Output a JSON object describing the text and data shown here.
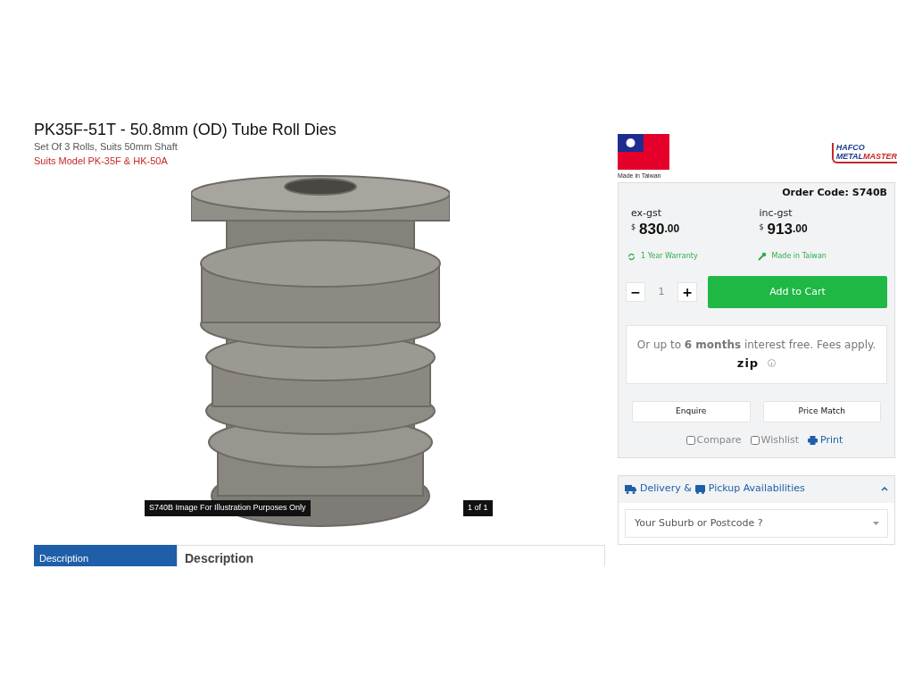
{
  "product": {
    "title": "PK35F-51T - 50.8mm (OD) Tube Roll Dies",
    "subtitle": "Set Of 3 Rolls, Suits 50mm Shaft",
    "suits": "Suits Model PK-35F & HK-50A"
  },
  "gallery": {
    "caption": "S740B Image For Illustration Purposes Only",
    "counter": "1 of 1"
  },
  "tabs": [
    {
      "label": "Description",
      "selected": true
    }
  ],
  "description_heading": "Description",
  "origin": {
    "label": "Made in Taiwan"
  },
  "brand": {
    "line1": "HAFCO",
    "line2a": "METAL",
    "line2b": "MASTER"
  },
  "buy_box": {
    "order_code": "Order Code: S740B",
    "prices": [
      {
        "label": "ex-gst",
        "currency": "$",
        "whole": "830",
        "cents": ".00"
      },
      {
        "label": "inc-gst",
        "currency": "$",
        "whole": "913",
        "cents": ".00"
      }
    ],
    "features": [
      {
        "kind": "warranty",
        "text": "1 Year Warranty"
      },
      {
        "kind": "origin",
        "text": "Made in Taiwan"
      }
    ],
    "quantity": {
      "minus": "−",
      "value": "1",
      "plus": "+"
    },
    "add_to_cart": "Add to Cart",
    "finance": {
      "text": "Or up to **6 months** interest free. Fees apply.",
      "logo": "zip"
    },
    "buttons": [
      "Enquire",
      "Price Match"
    ],
    "options": [
      {
        "kind": "checkbox",
        "label": "Compare",
        "checked": false
      },
      {
        "kind": "checkbox",
        "label": "Wishlist",
        "checked": false
      },
      {
        "kind": "link",
        "label": "Print"
      }
    ]
  },
  "delivery": {
    "title_a": "Delivery &",
    "title_b": "Pickup Availabilities",
    "expanded": true,
    "placeholder": "Your Suburb or Postcode ?"
  }
}
